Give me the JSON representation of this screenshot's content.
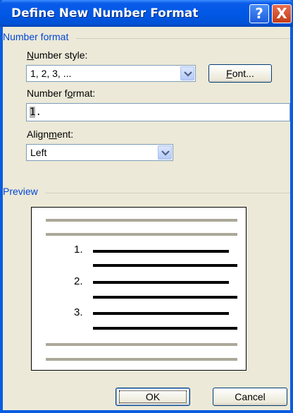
{
  "window": {
    "title": "Define New Number Format",
    "help_glyph": "?",
    "close_glyph": "X"
  },
  "number_format_group": {
    "label": "Number format",
    "number_style": {
      "label_prefix": "N",
      "label_rest": "umber style:",
      "value": "1, 2, 3, ..."
    },
    "font_button": {
      "label_prefix": "F",
      "label_rest": "ont..."
    },
    "number_format": {
      "label_before": "Number f",
      "label_underlined": "o",
      "label_after": "rmat:",
      "value_selected": "1",
      "value_rest": "."
    },
    "alignment": {
      "label_before": "Align",
      "label_underlined": "m",
      "label_after": "ent:",
      "value": "Left"
    }
  },
  "preview_group": {
    "label": "Preview",
    "items": [
      "1.",
      "2.",
      "3."
    ]
  },
  "footer": {
    "ok_label": "OK",
    "cancel_label": "Cancel"
  },
  "colors": {
    "titlebar": "#0058e6",
    "group_label": "#0046d5",
    "dialog_bg": "#ece9d8",
    "preview_number": "#000000",
    "preview_gray_line": "#aca899"
  }
}
